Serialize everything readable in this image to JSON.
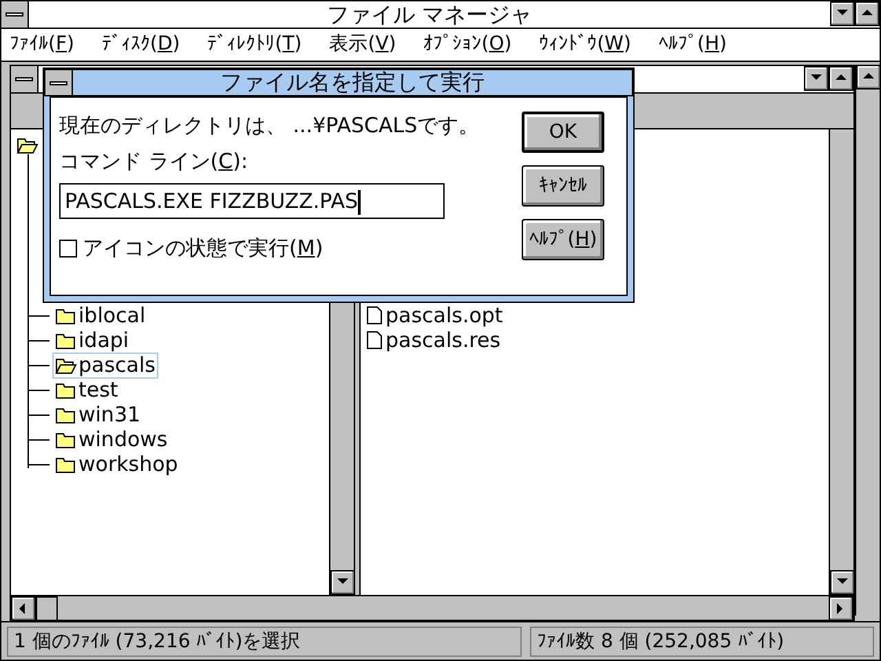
{
  "window": {
    "title": "ファイル マネージャ"
  },
  "menu": [
    {
      "before": "ﾌｧｲﾙ(",
      "key": "F",
      "after": ")"
    },
    {
      "before": "ﾃﾞｨｽｸ(",
      "key": "D",
      "after": ")"
    },
    {
      "before": "ﾃﾞｨﾚｸﾄﾘ(",
      "key": "T",
      "after": ")"
    },
    {
      "before": "表示(",
      "key": "V",
      "after": ")"
    },
    {
      "before": "ｵﾌﾟｼｮﾝ(",
      "key": "O",
      "after": ")"
    },
    {
      "before": "ｳｨﾝﾄﾞｳ(",
      "key": "W",
      "after": ")"
    },
    {
      "before": "ﾍﾙﾌﾟ(",
      "key": "H",
      "after": ")"
    }
  ],
  "tree": {
    "children": [
      {
        "name": "iblocal",
        "selected": false
      },
      {
        "name": "idapi",
        "selected": false
      },
      {
        "name": "pascals",
        "selected": true
      },
      {
        "name": "test",
        "selected": false
      },
      {
        "name": "win31",
        "selected": false
      },
      {
        "name": "windows",
        "selected": false
      },
      {
        "name": "workshop",
        "selected": false
      }
    ]
  },
  "files": [
    {
      "name": "pascals.opt"
    },
    {
      "name": "pascals.res"
    }
  ],
  "dialog": {
    "title": "ファイル名を指定して実行",
    "current_dir": "現在のディレクトリは、 ...¥PASCALSです。",
    "command_label": {
      "before": "コマンド ライン(",
      "key": "C",
      "after": "):"
    },
    "command_value": "PASCALS.EXE FIZZBUZZ.PAS",
    "minimized": {
      "before": "アイコンの状態で実行(",
      "key": "M",
      "after": ")",
      "checked": false
    },
    "buttons": [
      {
        "before": "OK",
        "default": true
      },
      {
        "before": "ｷｬﾝｾﾙ",
        "default": false
      },
      {
        "before": "ﾍﾙﾌﾟ(",
        "key": "H",
        "after": ")",
        "default": false
      }
    ]
  },
  "status_bar": {
    "selection": "1 個のﾌｧｲﾙ (73,216 ﾊﾞｲﾄ)を選択",
    "totals": "ﾌｧｲﾙ数 8 個 (252,085 ﾊﾞｲﾄ)"
  }
}
